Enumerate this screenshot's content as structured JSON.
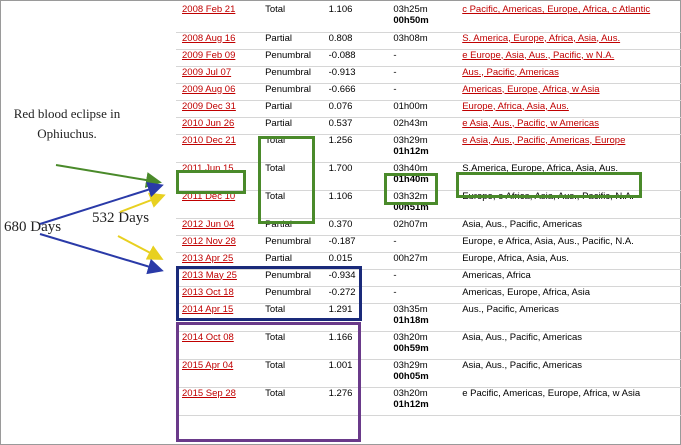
{
  "annotations": {
    "red_blood_note": "Red blood eclipse in Ophiuchus.",
    "days_680": "680 Days",
    "days_532": "532 Days"
  },
  "colors": {
    "green_box": "#4a8a2a",
    "navy_box": "#1a2a7a",
    "purple_box": "#6a3a8a",
    "yellow_arrow": "#e8d020",
    "blue_arrow": "#2a3aa8",
    "link_red": "#c00000"
  },
  "eclipses": [
    {
      "date": "2008 Feb 21",
      "type": "Total",
      "gamma": "1.106",
      "duration": "03h25m",
      "duration_total": "00h50m",
      "regions": "c Pacific, Americas, Europe, Africa, c Atlantic",
      "regions_link": true
    },
    {
      "date": "2008 Aug 16",
      "type": "Partial",
      "gamma": "0.808",
      "duration": "03h08m",
      "duration_total": "",
      "regions": "S. America, Europe, Africa, Asia, Aus.",
      "regions_link": true
    },
    {
      "date": "2009 Feb 09",
      "type": "Penumbral",
      "gamma": "-0.088",
      "duration": "-",
      "duration_total": "",
      "regions": "e Europe, Asia, Aus., Pacific, w N.A.",
      "regions_link": true
    },
    {
      "date": "2009 Jul 07",
      "type": "Penumbral",
      "gamma": "-0.913",
      "duration": "-",
      "duration_total": "",
      "regions": "Aus., Pacific, Americas",
      "regions_link": true
    },
    {
      "date": "2009 Aug 06",
      "type": "Penumbral",
      "gamma": "-0.666",
      "duration": "-",
      "duration_total": "",
      "regions": "Americas, Europe, Africa, w Asia",
      "regions_link": true
    },
    {
      "date": "2009 Dec 31",
      "type": "Partial",
      "gamma": "0.076",
      "duration": "01h00m",
      "duration_total": "",
      "regions": "Europe, Africa, Asia, Aus.",
      "regions_link": true
    },
    {
      "date": "2010 Jun 26",
      "type": "Partial",
      "gamma": "0.537",
      "duration": "02h43m",
      "duration_total": "",
      "regions": "e Asia, Aus., Pacific, w Americas",
      "regions_link": true
    },
    {
      "date": "2010 Dec 21",
      "type": "Total",
      "gamma": "1.256",
      "duration": "03h29m",
      "duration_total": "01h12m",
      "regions": "e Asia, Aus., Pacific, Americas, Europe",
      "regions_link": true
    },
    {
      "date": "2011 Jun 15",
      "type": "Total",
      "gamma": "1.700",
      "duration": "03h40m",
      "duration_total": "01h40m",
      "regions": "S.America, Europe, Africa, Asia, Aus.",
      "regions_link": false
    },
    {
      "date": "2011 Dec 10",
      "type": "Total",
      "gamma": "1.106",
      "duration": "03h32m",
      "duration_total": "00h51m",
      "regions": "Europe, e Africa, Asia, Aus., Pacific, N.A.",
      "regions_link": false
    },
    {
      "date": "2012 Jun 04",
      "type": "Partial",
      "gamma": "0.370",
      "duration": "02h07m",
      "duration_total": "",
      "regions": "Asia, Aus., Pacific, Americas",
      "regions_link": false
    },
    {
      "date": "2012 Nov 28",
      "type": "Penumbral",
      "gamma": "-0.187",
      "duration": "-",
      "duration_total": "",
      "regions": "Europe, e Africa, Asia, Aus., Pacific, N.A.",
      "regions_link": false
    },
    {
      "date": "2013 Apr 25",
      "type": "Partial",
      "gamma": "0.015",
      "duration": "00h27m",
      "duration_total": "",
      "regions": "Europe, Africa, Asia, Aus.",
      "regions_link": false
    },
    {
      "date": "2013 May 25",
      "type": "Penumbral",
      "gamma": "-0.934",
      "duration": "-",
      "duration_total": "",
      "regions": "Americas, Africa",
      "regions_link": false
    },
    {
      "date": "2013 Oct 18",
      "type": "Penumbral",
      "gamma": "-0.272",
      "duration": "-",
      "duration_total": "",
      "regions": "Americas, Europe, Africa, Asia",
      "regions_link": false
    },
    {
      "date": "2014 Apr 15",
      "type": "Total",
      "gamma": "1.291",
      "duration": "03h35m",
      "duration_total": "01h18m",
      "regions": "Aus., Pacific, Americas",
      "regions_link": false
    },
    {
      "date": "2014 Oct 08",
      "type": "Total",
      "gamma": "1.166",
      "duration": "03h20m",
      "duration_total": "00h59m",
      "regions": "Asia, Aus., Pacific, Americas",
      "regions_link": false
    },
    {
      "date": "2015 Apr 04",
      "type": "Total",
      "gamma": "1.001",
      "duration": "03h29m",
      "duration_total": "00h05m",
      "regions": "Asia, Aus., Pacific, Americas",
      "regions_link": false
    },
    {
      "date": "2015 Sep 28",
      "type": "Total",
      "gamma": "1.276",
      "duration": "03h20m",
      "duration_total": "01h12m",
      "regions": "e Pacific, Americas, Europe, Africa, w Asia",
      "regions_link": false
    }
  ]
}
